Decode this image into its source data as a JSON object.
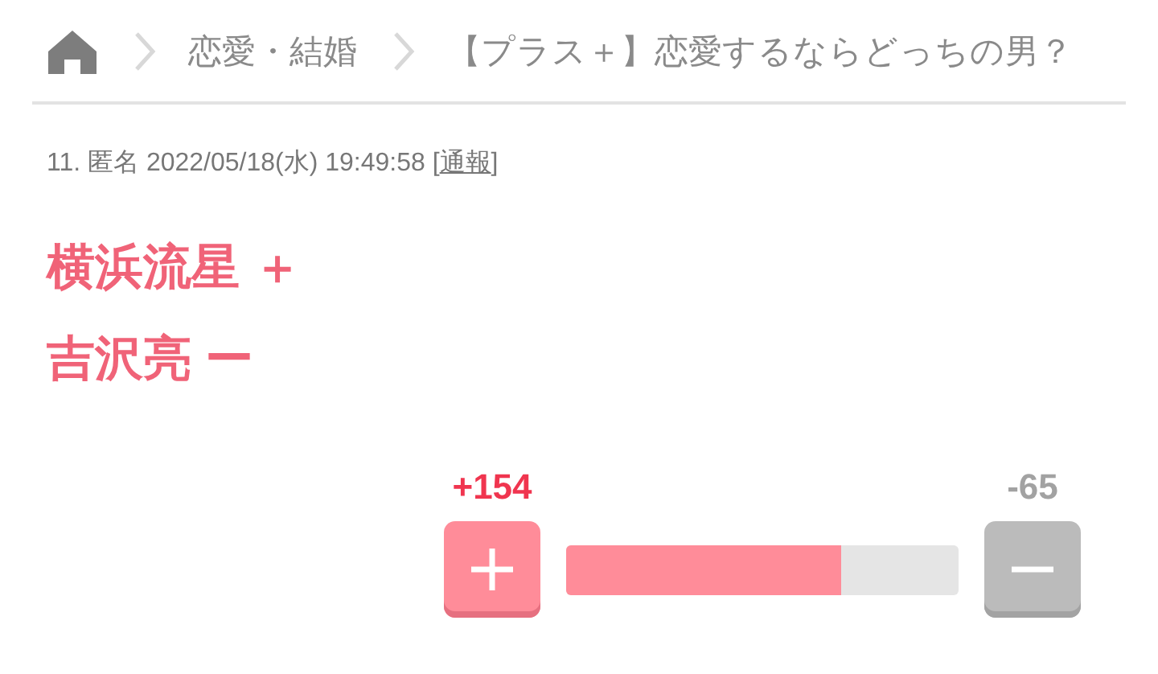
{
  "breadcrumb": [
    "恋愛・結婚",
    "【プラス＋】恋愛するならどっちの男？"
  ],
  "comment": {
    "number": "11.",
    "author": "匿名",
    "date": "2022/05/18(水) 19:49:58",
    "report_open": "[",
    "report_link": "通報",
    "report_close": "]",
    "lines": [
      "横浜流星 ＋",
      "吉沢亮 ー"
    ]
  },
  "vote": {
    "plus_count": "+154",
    "minus_count": "-65",
    "level": 0.7
  }
}
